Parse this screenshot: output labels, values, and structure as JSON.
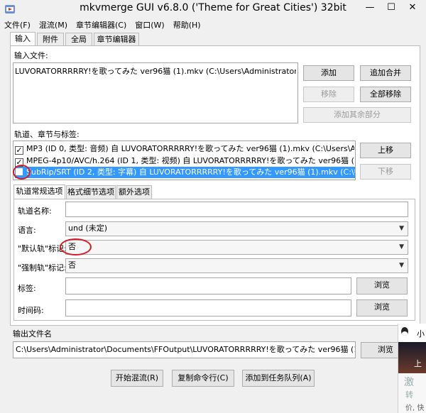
{
  "window": {
    "title": "mkvmerge GUI v6.8.0 ('Theme for Great Cities') 32bit",
    "minimize": "—",
    "maximize": "☐",
    "close": "✕"
  },
  "menu": [
    "文件(F)",
    "混流(M)",
    "章节编辑器(C)",
    "窗口(W)",
    "帮助(H)"
  ],
  "tabs": [
    "输入",
    "附件",
    "全局",
    "章节编辑器"
  ],
  "input_files": {
    "label": "输入文件:",
    "items": [
      "LUVORATORRRRRY!を歌ってみた ver96猫 (1).mkv (C:\\Users\\Administrator\\Documents)"
    ],
    "buttons": {
      "add": "添加",
      "append": "追加合并",
      "remove": "移除",
      "remove_all": "全部移除",
      "add_other": "添加其余部分"
    }
  },
  "tracks": {
    "label": "轨道、章节与标签:",
    "items": [
      {
        "checked": true,
        "text": "MP3 (ID 0, 类型: 音频) 自 LUVORATORRRRRY!を歌ってみた ver96猫 (1).mkv (C:\\Users\\Administrator"
      },
      {
        "checked": true,
        "text": "MPEG-4p10/AVC/h.264 (ID 1, 类型: 视频) 自 LUVORATORRRRRY!を歌ってみた ver96猫 (1).mkv"
      },
      {
        "checked": false,
        "text": "SubRip/SRT (ID 2, 类型: 字幕) 自 LUVORATORRRRRY!を歌ってみた ver96猫 (1).mkv (C:\\Users\\Ad"
      }
    ],
    "buttons": {
      "up": "上移",
      "down": "下移"
    }
  },
  "subtabs": [
    "轨道常规选项",
    "格式细节选项",
    "额外选项"
  ],
  "fields": {
    "track_name_label": "轨道名称:",
    "track_name_value": "",
    "language_label": "语言:",
    "language_value": "und (未定)",
    "default_label": "\"默认轨\"标记:",
    "default_value": "否",
    "forced_label": "\"强制轨\"标记:",
    "forced_value": "否",
    "tags_label": "标签:",
    "tags_value": "",
    "timecodes_label": "时间码:",
    "timecodes_value": "",
    "browse": "浏览"
  },
  "output": {
    "label": "输出文件名",
    "value": "C:\\Users\\Administrator\\Documents\\FFOutput\\LUVORATORRRRRY!を歌ってみた ver96猫 (1) (1).m",
    "browse": "浏览"
  },
  "bottom_buttons": {
    "start": "开始混流(R)",
    "copy": "复制命令行(C)",
    "queue": "添加到任务队列(A)"
  },
  "popup": {
    "line1": "小",
    "line2": "上",
    "line3": "激",
    "line4": "转",
    "line5": "价, 快"
  },
  "colors": {
    "selection": "#3399ff",
    "annotation": "#d21d25"
  }
}
